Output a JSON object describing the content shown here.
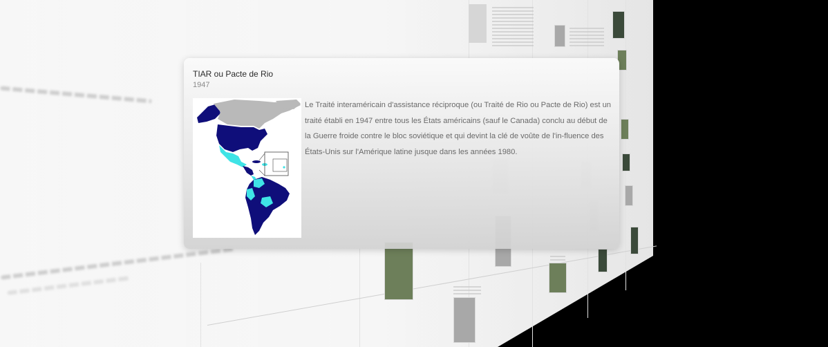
{
  "popup": {
    "title": "TIAR ou Pacte de Rio",
    "year": "1947",
    "description": "Le Traité interaméricain d'assistance réciproque (ou Traité de Rio ou Pacte de Rio) est un traité établi en 1947 entre tous les États américains (sauf le Canada) conclu au début de la Guerre froide contre le bloc soviétique et qui devint la clé de voûte de l'in-fluence des États-Unis sur l'Amérique latine jusque dans les années 1980.",
    "image_icon": "americas-map-icon"
  },
  "colors": {
    "members": "#0f0e7a",
    "signatories": "#3fe3e6",
    "non_members": "#b9b9b9",
    "background": "#000000",
    "wall": "#f7f7f7"
  }
}
